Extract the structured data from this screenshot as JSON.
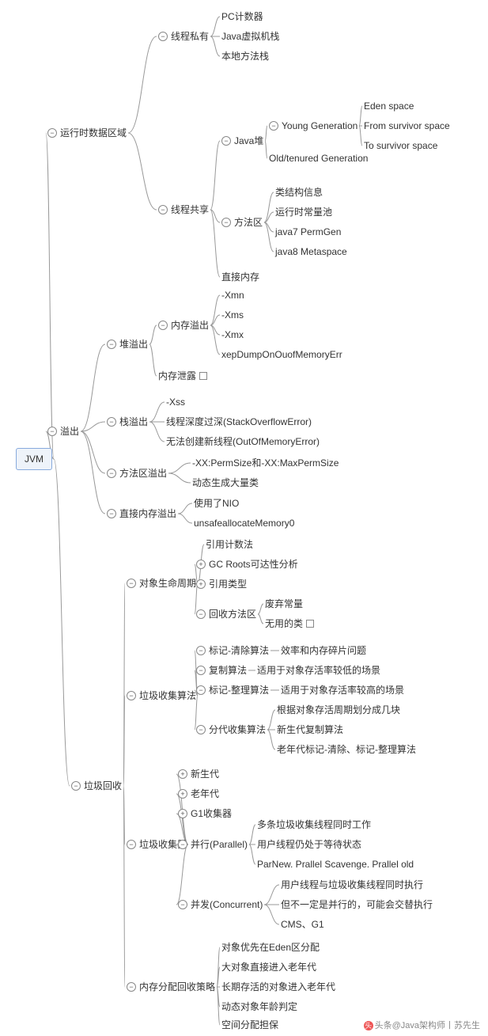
{
  "root": "JVM",
  "footer": "头条@Java架构师丨苏先生",
  "n": {
    "a": "运行时数据区域",
    "a1": "线程私有",
    "a1a": "PC计数器",
    "a1b": "Java虚拟机栈",
    "a1c": "本地方法栈",
    "a2": "线程共享",
    "a2a": "Java堆",
    "a2a1": "Young Generation",
    "a2a1a": "Eden space",
    "a2a1b": "From survivor space",
    "a2a1c": "To survivor space",
    "a2a2": "Old/tenured Generation",
    "a2b": "方法区",
    "a2b1": "类结构信息",
    "a2b2": "运行时常量池",
    "a2b3": "java7 PermGen",
    "a2b4": "java8 Metaspace",
    "a2c": "直接内存",
    "b": "溢出",
    "b1": "堆溢出",
    "b1a": "内存溢出",
    "b1a1": "-Xmn",
    "b1a2": "-Xms",
    "b1a3": "-Xmx",
    "b1a4": "xepDumpOnOuofMemoryErr",
    "b1b": "内存泄露",
    "b2": "栈溢出",
    "b2a": "-Xss",
    "b2b": "线程深度过深(StackOverflowError)",
    "b2c": "无法创建新线程(OutOfMemoryError)",
    "b3": "方法区溢出",
    "b3a": "-XX:PermSize和-XX:MaxPermSize",
    "b3b": "动态生成大量类",
    "b4": "直接内存溢出",
    "b4a": "使用了NIO",
    "b4b": "unsafeallocateMemory0",
    "c": "垃圾回收",
    "c1": "对象生命周期",
    "c1a": "引用计数法",
    "c1b": "GC Roots可达性分析",
    "c1c": "引用类型",
    "c1d": "回收方法区",
    "c1d1": "废弃常量",
    "c1d2": "无用的类",
    "c2": "垃圾收集算法",
    "c2a": "标记-清除算法",
    "c2a1": "效率和内存碎片问题",
    "c2b": "复制算法",
    "c2b1": "适用于对象存活率较低的场景",
    "c2c": "标记-整理算法",
    "c2c1": "适用于对象存活率较高的场景",
    "c2d": "分代收集算法",
    "c2d1": "根据对象存活周期划分成几块",
    "c2d2": "新生代复制算法",
    "c2d3": "老年代标记-清除、标记-整理算法",
    "c3": "垃圾收集器",
    "c3a": "新生代",
    "c3b": "老年代",
    "c3c": "G1收集器",
    "c3d": "并行(Parallel)",
    "c3d1": "多条垃圾收集线程同时工作",
    "c3d2": "用户线程仍处于等待状态",
    "c3d3": "ParNew. Prallel Scavenge. Prallel old",
    "c3e": "并发(Concurrent)",
    "c3e1": "用户线程与垃圾收集线程同时执行",
    "c3e2": "但不一定是并行的，可能会交替执行",
    "c3e3": "CMS、G1",
    "c4": "内存分配回收策略",
    "c4a": "对象优先在Eden区分配",
    "c4b": "大对象直接进入老年代",
    "c4c": "长期存活的对象进入老年代",
    "c4d": "动态对象年龄判定",
    "c4e": "空间分配担保"
  }
}
